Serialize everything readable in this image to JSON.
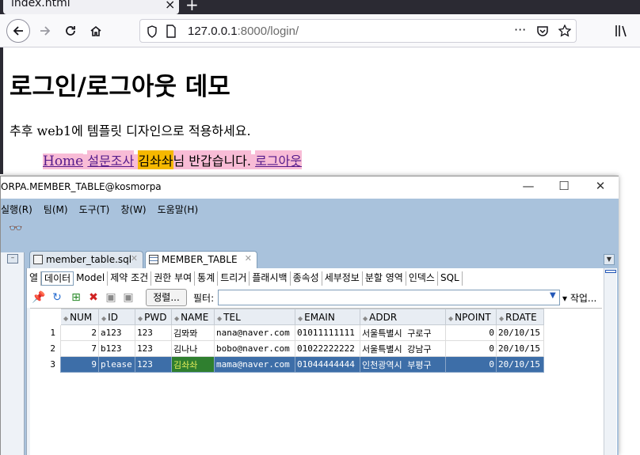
{
  "browser": {
    "tab_title": "index.html",
    "tab_close": "×",
    "new_tab": "+",
    "url_host": "127.0.0.1",
    "url_rest": ":8000/login/",
    "more": "···"
  },
  "page": {
    "title": "로그인/로그아웃 데모",
    "subtitle": "추후 web1에 템플릿 디자인으로 적용하세요.",
    "nav": {
      "home": "Home",
      "survey": "설문조사",
      "user": "김솨솨",
      "greeting": "님 반갑습니다.",
      "logout": "로그아웃"
    }
  },
  "sqldev": {
    "window_title": "ORPA.MEMBER_TABLE@kosmorpa",
    "menu": [
      "실행(R)",
      "팀(M)",
      "도구(T)",
      "창(W)",
      "도움말(H)"
    ],
    "tabs": [
      {
        "label": "member_table.sql"
      },
      {
        "label": "MEMBER_TABLE"
      }
    ],
    "subtabs": [
      "열",
      "데이터",
      "Model",
      "제약 조건",
      "권한 부여",
      "통계",
      "트리거",
      "플래시백",
      "종속성",
      "세부정보",
      "분할 영역",
      "인덱스",
      "SQL"
    ],
    "toolbar": {
      "sort": "정렬...",
      "filter_label": "필터:",
      "filter_value": "",
      "actions": "▾ 작업..."
    },
    "grid": {
      "columns": [
        "NUM",
        "ID",
        "PWD",
        "NAME",
        "TEL",
        "EMAIN",
        "ADDR",
        "NPOINT",
        "RDATE"
      ],
      "rows": [
        {
          "rownum": "1",
          "NUM": "2",
          "ID": "a123",
          "PWD": "123",
          "NAME": "김뫄뫄",
          "TEL": "nana@naver.com",
          "EMAIN": "01011111111",
          "ADDR": "서울특별시 구로구",
          "NPOINT": "0",
          "RDATE": "20/10/15"
        },
        {
          "rownum": "2",
          "NUM": "7",
          "ID": "b123",
          "PWD": "123",
          "NAME": "김나나",
          "TEL": "bobo@naver.com",
          "EMAIN": "01022222222",
          "ADDR": "서울특별시 강남구",
          "NPOINT": "0",
          "RDATE": "20/10/15"
        },
        {
          "rownum": "3",
          "NUM": "9",
          "ID": "please",
          "PWD": "123",
          "NAME": "김솨솨",
          "TEL": "mama@naver.com",
          "EMAIN": "01044444444",
          "ADDR": "인천광역시 부평구",
          "NPOINT": "0",
          "RDATE": "20/10/15"
        }
      ]
    }
  }
}
